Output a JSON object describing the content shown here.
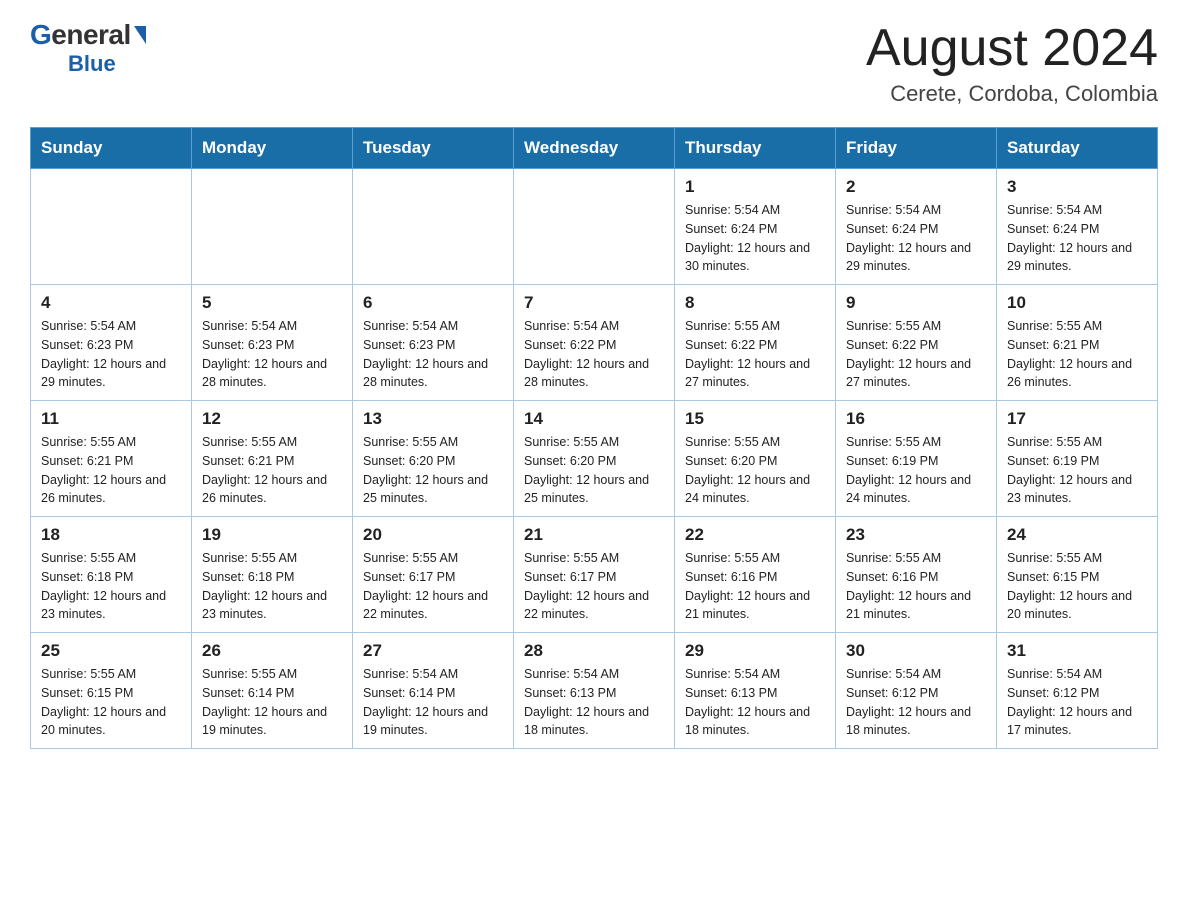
{
  "header": {
    "logo_general": "General",
    "logo_blue": "Blue",
    "month_year": "August 2024",
    "location": "Cerete, Cordoba, Colombia"
  },
  "days_of_week": [
    "Sunday",
    "Monday",
    "Tuesday",
    "Wednesday",
    "Thursday",
    "Friday",
    "Saturday"
  ],
  "weeks": [
    [
      {
        "day": "",
        "sunrise": "",
        "sunset": "",
        "daylight": ""
      },
      {
        "day": "",
        "sunrise": "",
        "sunset": "",
        "daylight": ""
      },
      {
        "day": "",
        "sunrise": "",
        "sunset": "",
        "daylight": ""
      },
      {
        "day": "",
        "sunrise": "",
        "sunset": "",
        "daylight": ""
      },
      {
        "day": "1",
        "sunrise": "Sunrise: 5:54 AM",
        "sunset": "Sunset: 6:24 PM",
        "daylight": "Daylight: 12 hours and 30 minutes."
      },
      {
        "day": "2",
        "sunrise": "Sunrise: 5:54 AM",
        "sunset": "Sunset: 6:24 PM",
        "daylight": "Daylight: 12 hours and 29 minutes."
      },
      {
        "day": "3",
        "sunrise": "Sunrise: 5:54 AM",
        "sunset": "Sunset: 6:24 PM",
        "daylight": "Daylight: 12 hours and 29 minutes."
      }
    ],
    [
      {
        "day": "4",
        "sunrise": "Sunrise: 5:54 AM",
        "sunset": "Sunset: 6:23 PM",
        "daylight": "Daylight: 12 hours and 29 minutes."
      },
      {
        "day": "5",
        "sunrise": "Sunrise: 5:54 AM",
        "sunset": "Sunset: 6:23 PM",
        "daylight": "Daylight: 12 hours and 28 minutes."
      },
      {
        "day": "6",
        "sunrise": "Sunrise: 5:54 AM",
        "sunset": "Sunset: 6:23 PM",
        "daylight": "Daylight: 12 hours and 28 minutes."
      },
      {
        "day": "7",
        "sunrise": "Sunrise: 5:54 AM",
        "sunset": "Sunset: 6:22 PM",
        "daylight": "Daylight: 12 hours and 28 minutes."
      },
      {
        "day": "8",
        "sunrise": "Sunrise: 5:55 AM",
        "sunset": "Sunset: 6:22 PM",
        "daylight": "Daylight: 12 hours and 27 minutes."
      },
      {
        "day": "9",
        "sunrise": "Sunrise: 5:55 AM",
        "sunset": "Sunset: 6:22 PM",
        "daylight": "Daylight: 12 hours and 27 minutes."
      },
      {
        "day": "10",
        "sunrise": "Sunrise: 5:55 AM",
        "sunset": "Sunset: 6:21 PM",
        "daylight": "Daylight: 12 hours and 26 minutes."
      }
    ],
    [
      {
        "day": "11",
        "sunrise": "Sunrise: 5:55 AM",
        "sunset": "Sunset: 6:21 PM",
        "daylight": "Daylight: 12 hours and 26 minutes."
      },
      {
        "day": "12",
        "sunrise": "Sunrise: 5:55 AM",
        "sunset": "Sunset: 6:21 PM",
        "daylight": "Daylight: 12 hours and 26 minutes."
      },
      {
        "day": "13",
        "sunrise": "Sunrise: 5:55 AM",
        "sunset": "Sunset: 6:20 PM",
        "daylight": "Daylight: 12 hours and 25 minutes."
      },
      {
        "day": "14",
        "sunrise": "Sunrise: 5:55 AM",
        "sunset": "Sunset: 6:20 PM",
        "daylight": "Daylight: 12 hours and 25 minutes."
      },
      {
        "day": "15",
        "sunrise": "Sunrise: 5:55 AM",
        "sunset": "Sunset: 6:20 PM",
        "daylight": "Daylight: 12 hours and 24 minutes."
      },
      {
        "day": "16",
        "sunrise": "Sunrise: 5:55 AM",
        "sunset": "Sunset: 6:19 PM",
        "daylight": "Daylight: 12 hours and 24 minutes."
      },
      {
        "day": "17",
        "sunrise": "Sunrise: 5:55 AM",
        "sunset": "Sunset: 6:19 PM",
        "daylight": "Daylight: 12 hours and 23 minutes."
      }
    ],
    [
      {
        "day": "18",
        "sunrise": "Sunrise: 5:55 AM",
        "sunset": "Sunset: 6:18 PM",
        "daylight": "Daylight: 12 hours and 23 minutes."
      },
      {
        "day": "19",
        "sunrise": "Sunrise: 5:55 AM",
        "sunset": "Sunset: 6:18 PM",
        "daylight": "Daylight: 12 hours and 23 minutes."
      },
      {
        "day": "20",
        "sunrise": "Sunrise: 5:55 AM",
        "sunset": "Sunset: 6:17 PM",
        "daylight": "Daylight: 12 hours and 22 minutes."
      },
      {
        "day": "21",
        "sunrise": "Sunrise: 5:55 AM",
        "sunset": "Sunset: 6:17 PM",
        "daylight": "Daylight: 12 hours and 22 minutes."
      },
      {
        "day": "22",
        "sunrise": "Sunrise: 5:55 AM",
        "sunset": "Sunset: 6:16 PM",
        "daylight": "Daylight: 12 hours and 21 minutes."
      },
      {
        "day": "23",
        "sunrise": "Sunrise: 5:55 AM",
        "sunset": "Sunset: 6:16 PM",
        "daylight": "Daylight: 12 hours and 21 minutes."
      },
      {
        "day": "24",
        "sunrise": "Sunrise: 5:55 AM",
        "sunset": "Sunset: 6:15 PM",
        "daylight": "Daylight: 12 hours and 20 minutes."
      }
    ],
    [
      {
        "day": "25",
        "sunrise": "Sunrise: 5:55 AM",
        "sunset": "Sunset: 6:15 PM",
        "daylight": "Daylight: 12 hours and 20 minutes."
      },
      {
        "day": "26",
        "sunrise": "Sunrise: 5:55 AM",
        "sunset": "Sunset: 6:14 PM",
        "daylight": "Daylight: 12 hours and 19 minutes."
      },
      {
        "day": "27",
        "sunrise": "Sunrise: 5:54 AM",
        "sunset": "Sunset: 6:14 PM",
        "daylight": "Daylight: 12 hours and 19 minutes."
      },
      {
        "day": "28",
        "sunrise": "Sunrise: 5:54 AM",
        "sunset": "Sunset: 6:13 PM",
        "daylight": "Daylight: 12 hours and 18 minutes."
      },
      {
        "day": "29",
        "sunrise": "Sunrise: 5:54 AM",
        "sunset": "Sunset: 6:13 PM",
        "daylight": "Daylight: 12 hours and 18 minutes."
      },
      {
        "day": "30",
        "sunrise": "Sunrise: 5:54 AM",
        "sunset": "Sunset: 6:12 PM",
        "daylight": "Daylight: 12 hours and 18 minutes."
      },
      {
        "day": "31",
        "sunrise": "Sunrise: 5:54 AM",
        "sunset": "Sunset: 6:12 PM",
        "daylight": "Daylight: 12 hours and 17 minutes."
      }
    ]
  ]
}
